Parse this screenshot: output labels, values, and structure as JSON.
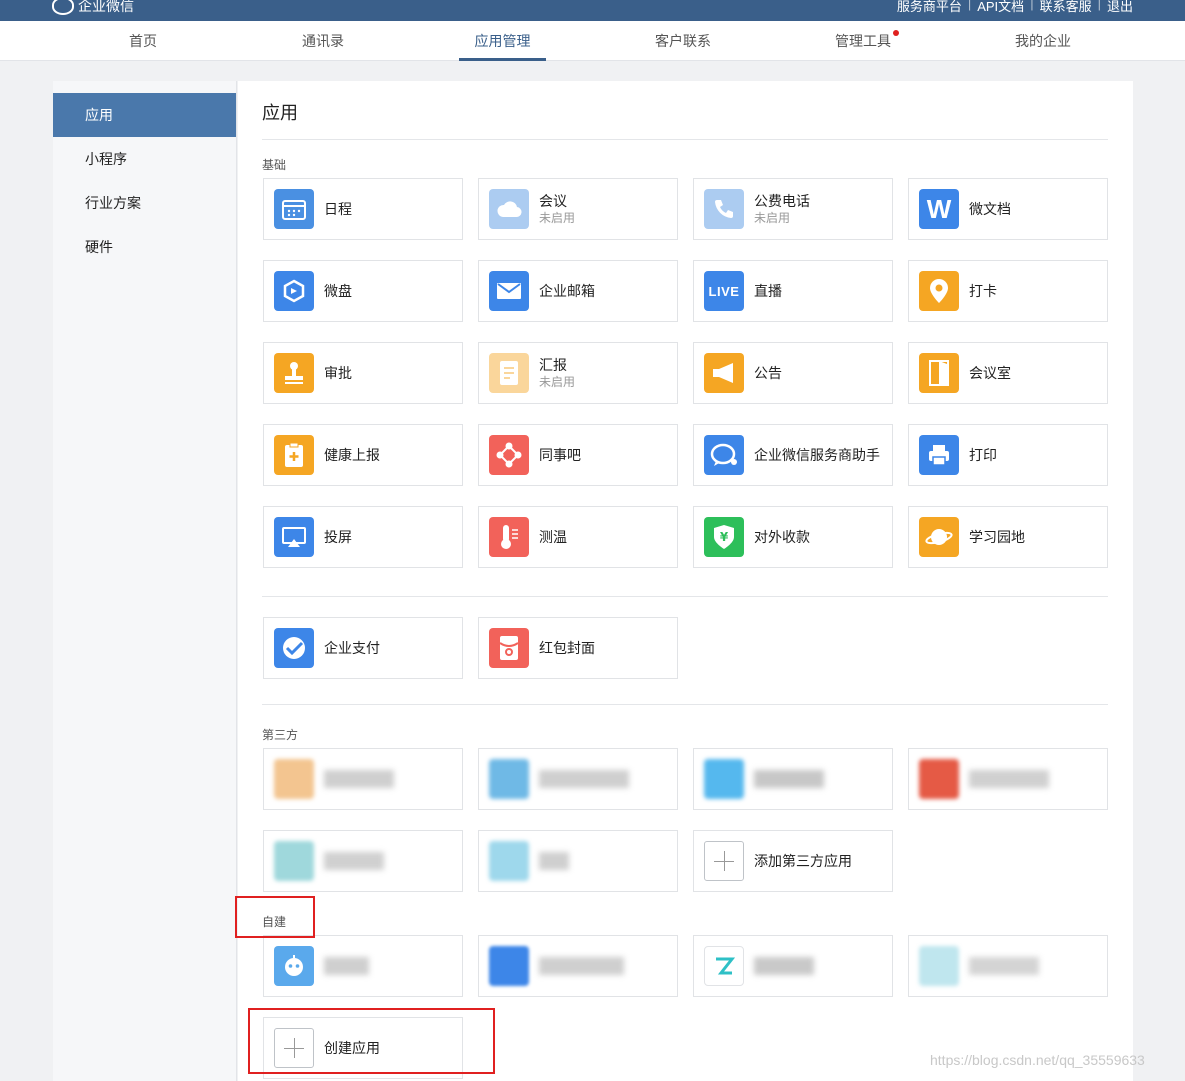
{
  "header": {
    "brand": "企业微信",
    "links": [
      "服务商平台",
      "API文档",
      "联系客服",
      "退出"
    ]
  },
  "nav": {
    "items": [
      "首页",
      "通讯录",
      "应用管理",
      "客户联系",
      "管理工具",
      "我的企业"
    ],
    "active": "应用管理"
  },
  "sidebar": {
    "items": [
      "应用",
      "小程序",
      "行业方案",
      "硬件"
    ],
    "active": "应用"
  },
  "main": {
    "title": "应用",
    "basic_label": "基础",
    "basic_apps": [
      {
        "name": "日程",
        "icon": "calendar-icon",
        "color": "#4a90e2"
      },
      {
        "name": "会议",
        "sub": "未启用",
        "icon": "cloud-icon",
        "color": "#4a90e2"
      },
      {
        "name": "公费电话",
        "sub": "未启用",
        "icon": "phone-icon",
        "color": "#4a90e2"
      },
      {
        "name": "微文档",
        "icon": "w-doc-icon",
        "color": "#3d86e8"
      },
      {
        "name": "微盘",
        "icon": "disk-icon",
        "color": "#3d86e8"
      },
      {
        "name": "企业邮箱",
        "icon": "mail-icon",
        "color": "#3d86e8"
      },
      {
        "name": "直播",
        "icon": "live-icon",
        "color": "#3d86e8"
      },
      {
        "name": "打卡",
        "icon": "location-icon",
        "color": "#f5a623"
      },
      {
        "name": "审批",
        "icon": "stamp-icon",
        "color": "#f5a623"
      },
      {
        "name": "汇报",
        "sub": "未启用",
        "icon": "report-icon",
        "color": "#f5a623"
      },
      {
        "name": "公告",
        "icon": "megaphone-icon",
        "color": "#f5a623"
      },
      {
        "name": "会议室",
        "icon": "door-icon",
        "color": "#f5a623"
      },
      {
        "name": "健康上报",
        "icon": "clipboard-icon",
        "color": "#f5a623"
      },
      {
        "name": "同事吧",
        "icon": "network-icon",
        "color": "#f2625a"
      },
      {
        "name": "企业微信服务商助手",
        "icon": "chat-icon",
        "color": "#3d86e8"
      },
      {
        "name": "打印",
        "icon": "printer-icon",
        "color": "#3d86e8"
      },
      {
        "name": "投屏",
        "icon": "screen-cast-icon",
        "color": "#3d86e8"
      },
      {
        "name": "测温",
        "icon": "thermometer-icon",
        "color": "#f2625a"
      },
      {
        "name": "对外收款",
        "icon": "yuan-shield-icon",
        "color": "#2dbf5a"
      },
      {
        "name": "学习园地",
        "icon": "planet-icon",
        "color": "#f5a623"
      }
    ],
    "pay_apps": [
      {
        "name": "企业支付",
        "icon": "pay-check-icon",
        "color": "#3d86e8"
      },
      {
        "name": "红包封面",
        "icon": "red-packet-icon",
        "color": "#f2625a"
      }
    ],
    "third_party_label": "第三方",
    "add_third_party": "添加第三方应用",
    "self_built_label": "自建",
    "create_app": "创建应用"
  },
  "watermark": "https://blog.csdn.net/qq_35559633"
}
